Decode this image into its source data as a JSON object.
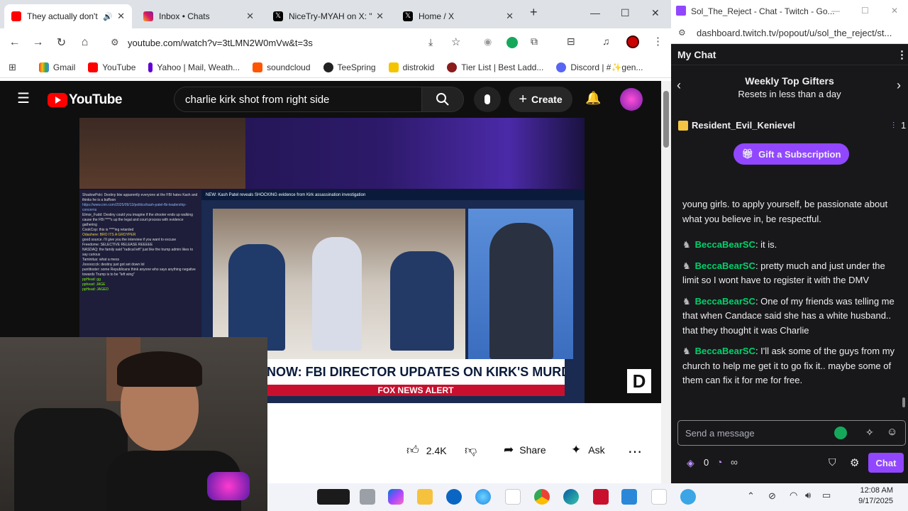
{
  "browser": {
    "tabs": [
      {
        "title": "They actually don't",
        "active": true
      },
      {
        "title": "Inbox • Chats",
        "active": false
      },
      {
        "title": "NiceTry-MYAH on X: \"A",
        "active": false
      },
      {
        "title": "Home / X",
        "active": false
      }
    ],
    "url": "youtube.com/watch?v=3tLMN2W0mVw&t=3s",
    "bookmarks": [
      "Gmail",
      "YouTube",
      "Yahoo | Mail, Weath...",
      "soundcloud",
      "TeeSpring",
      "distrokid",
      "Tier List | Best Ladd...",
      "Discord | #✨gen..."
    ]
  },
  "youtube": {
    "logo": "YouTube",
    "search_query": "charlie kirk shot from right side",
    "create_label": "Create",
    "video": {
      "ticker_top": "NEW: Kash Patel reveals SHOCKING evidence from Kirk assassination investigation",
      "lower_third": "NOW: FBI DIRECTOR UPDATES ON KIRK'S MURDER PROBE",
      "network_banner": "FOX NEWS ALERT",
      "chat_overlay": [
        "ShadowPoki: Destiny btw apparently everyone at the FBI hates Kash and thinks he is a buffoon",
        "https://www.cnn.com/2025/09/13/politics/kash-patel-fbi-leadership-concerns",
        "Elmor_Fudd: Destiny could you imagine if the shooter ends up walking cause the FBI ****s up the legal and court process with evidence gathering",
        "CookCop: this is ****ing retarded",
        "Odashere: BRO ITS A GROYPER",
        "good source. i'll give you the interview if you want to excuse",
        "Freedome: SELECTIVE RELEASE REEEEE",
        "NASDAQ: the family said \"radical left\" just like the trump admin likes to say curious",
        "Taminitus: what a mess",
        "Jooooccck: destiny just got set down lol",
        "puntitoster: some Republicans think anyone who says anything negative towards Trump is to be \"left wing\"",
        "ppHead: gg",
        "pphead: JAGE",
        "ppHead: JAGED"
      ]
    },
    "actions": {
      "likes": "2.4K",
      "share": "Share",
      "ask": "Ask"
    }
  },
  "twitch": {
    "window_title": "Sol_The_Reject - Chat - Twitch - Go...",
    "url": "dashboard.twitch.tv/popout/u/sol_the_reject/st...",
    "header": "My Chat",
    "gifters_title": "Weekly Top Gifters",
    "gifters_sub": "Resets in less than a day",
    "top_gifter": "Resident_Evil_Kenievel",
    "top_gifter_count": "1",
    "gift_button": "Gift a Subscription",
    "messages": [
      {
        "user": "",
        "text": "young girls. to apply yourself, be passionate about what you believe in, be respectful."
      },
      {
        "user": "BeccaBearSC",
        "text": ": it is."
      },
      {
        "user": "BeccaBearSC",
        "text": ": pretty much and just under the limit so I wont have to register it with the DMV"
      },
      {
        "user": "BeccaBearSC",
        "text": ": One of my friends was telling me that when Candace said she has a white husband.. that they thought it was Charlie"
      },
      {
        "user": "BeccaBearSC",
        "text": ": I'll ask some of the guys from my church to help me get it to go fix it.. maybe some of them can fix it for me for free."
      }
    ],
    "input_placeholder": "Send a message",
    "points": "0",
    "chat_button": "Chat"
  },
  "taskbar": {
    "time": "12:08 AM",
    "date": "9/17/2025"
  },
  "colors": {
    "twitch_purple": "#9147ff",
    "yt_red": "#ff0000",
    "twitch_green": "#00d26a"
  }
}
